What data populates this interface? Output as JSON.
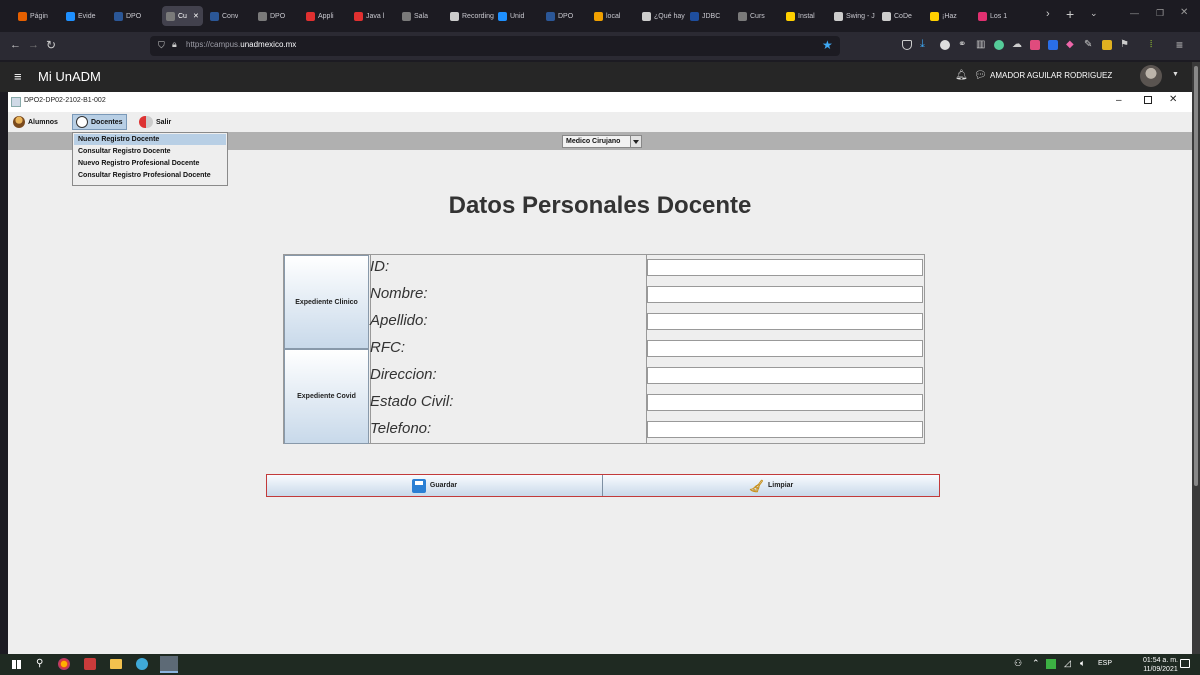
{
  "browser": {
    "tabs": [
      {
        "label": "Págin",
        "color": "#e66000"
      },
      {
        "label": "Evide",
        "color": "#1e90ff"
      },
      {
        "label": "DPO",
        "color": "#2b5797"
      },
      {
        "label": "Cu",
        "color": "#7a7a7a",
        "active": true
      },
      {
        "label": "Conv",
        "color": "#2b5797"
      },
      {
        "label": "DPO",
        "color": "#7a7a7a"
      },
      {
        "label": "Appli",
        "color": "#e03030"
      },
      {
        "label": "Java l",
        "color": "#e03030"
      },
      {
        "label": "Sala",
        "color": "#7a7a7a"
      },
      {
        "label": "Recording",
        "color": "#cccccc"
      },
      {
        "label": "Unid",
        "color": "#1e90ff"
      },
      {
        "label": "DPO",
        "color": "#2b5797"
      },
      {
        "label": "local",
        "color": "#f0a000"
      },
      {
        "label": "¿Qué hay",
        "color": "#cccccc"
      },
      {
        "label": "JDBC",
        "color": "#1e4e9e"
      },
      {
        "label": "Curs",
        "color": "#7a7a7a"
      },
      {
        "label": "Instal",
        "color": "#ffd000"
      },
      {
        "label": "Swing - J",
        "color": "#cccccc"
      },
      {
        "label": "CoDe",
        "color": "#cccccc"
      },
      {
        "label": "¡Haz",
        "color": "#ffd000"
      },
      {
        "label": "Los 1",
        "color": "#e03070"
      }
    ],
    "url_prefix": "https://campus.",
    "url_domain": "unadmexico.mx"
  },
  "site": {
    "title": "Mi UnADM",
    "user": "AMADOR AGUILAR RODRIGUEZ"
  },
  "app": {
    "window_title": "DPO2-DP02-2102-B1-002",
    "menu": {
      "alumnos": "Alumnos",
      "docentes": "Docentes",
      "salir": "Salir"
    },
    "dropdown_items": [
      "Nuevo Registro Docente",
      "Consultar Registro Docente",
      "Nuevo Registro Profesional Docente",
      "Consultar Registro Profesional Docente"
    ],
    "combo_value": "Medico Cirujano",
    "heading": "Datos Personales Docente",
    "side_buttons": {
      "clinico": "Expediente Clinico",
      "covid": "Expediente Covid"
    },
    "fields": [
      {
        "label": "ID:",
        "value": ""
      },
      {
        "label": "Nombre:",
        "value": ""
      },
      {
        "label": "Apellido:",
        "value": ""
      },
      {
        "label": "RFC:",
        "value": ""
      },
      {
        "label": "Direccion:",
        "value": ""
      },
      {
        "label": "Estado Civil:",
        "value": ""
      },
      {
        "label": "Telefono:",
        "value": ""
      }
    ],
    "buttons": {
      "guardar": "Guardar",
      "limpiar": "Limpiar"
    }
  },
  "taskbar": {
    "lang": "ESP",
    "time": "01:54 a. m.",
    "date": "11/09/2021"
  }
}
